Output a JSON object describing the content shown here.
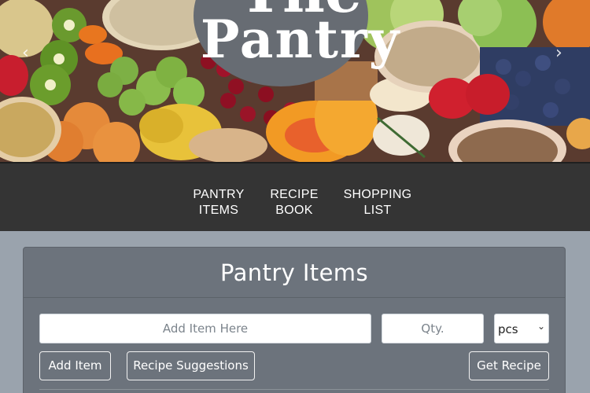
{
  "hero": {
    "logo_line1": "The",
    "logo_line2": "Pantry",
    "arrow_prev": "‹",
    "arrow_next": "›"
  },
  "nav": {
    "items": [
      {
        "line1": "PANTRY",
        "line2": "ITEMS"
      },
      {
        "line1": "RECIPE",
        "line2": "BOOK"
      },
      {
        "line1": "SHOPPING",
        "line2": "LIST"
      }
    ]
  },
  "pantry": {
    "title": "Pantry Items",
    "item_placeholder": "Add Item Here",
    "qty_placeholder": "Qty.",
    "unit_selected": "pcs",
    "add_button": "Add Item",
    "suggest_button": "Recipe Suggestions",
    "get_button": "Get Recipe"
  },
  "colors": {
    "navbar": "#343434",
    "page_background": "#9aa3ad",
    "card": "#6c737c",
    "logo_circle": "#676c73"
  },
  "icons": {
    "carousel_prev": "chevron-left-icon",
    "carousel_next": "chevron-right-icon",
    "select_caret": "chevron-down-icon"
  }
}
